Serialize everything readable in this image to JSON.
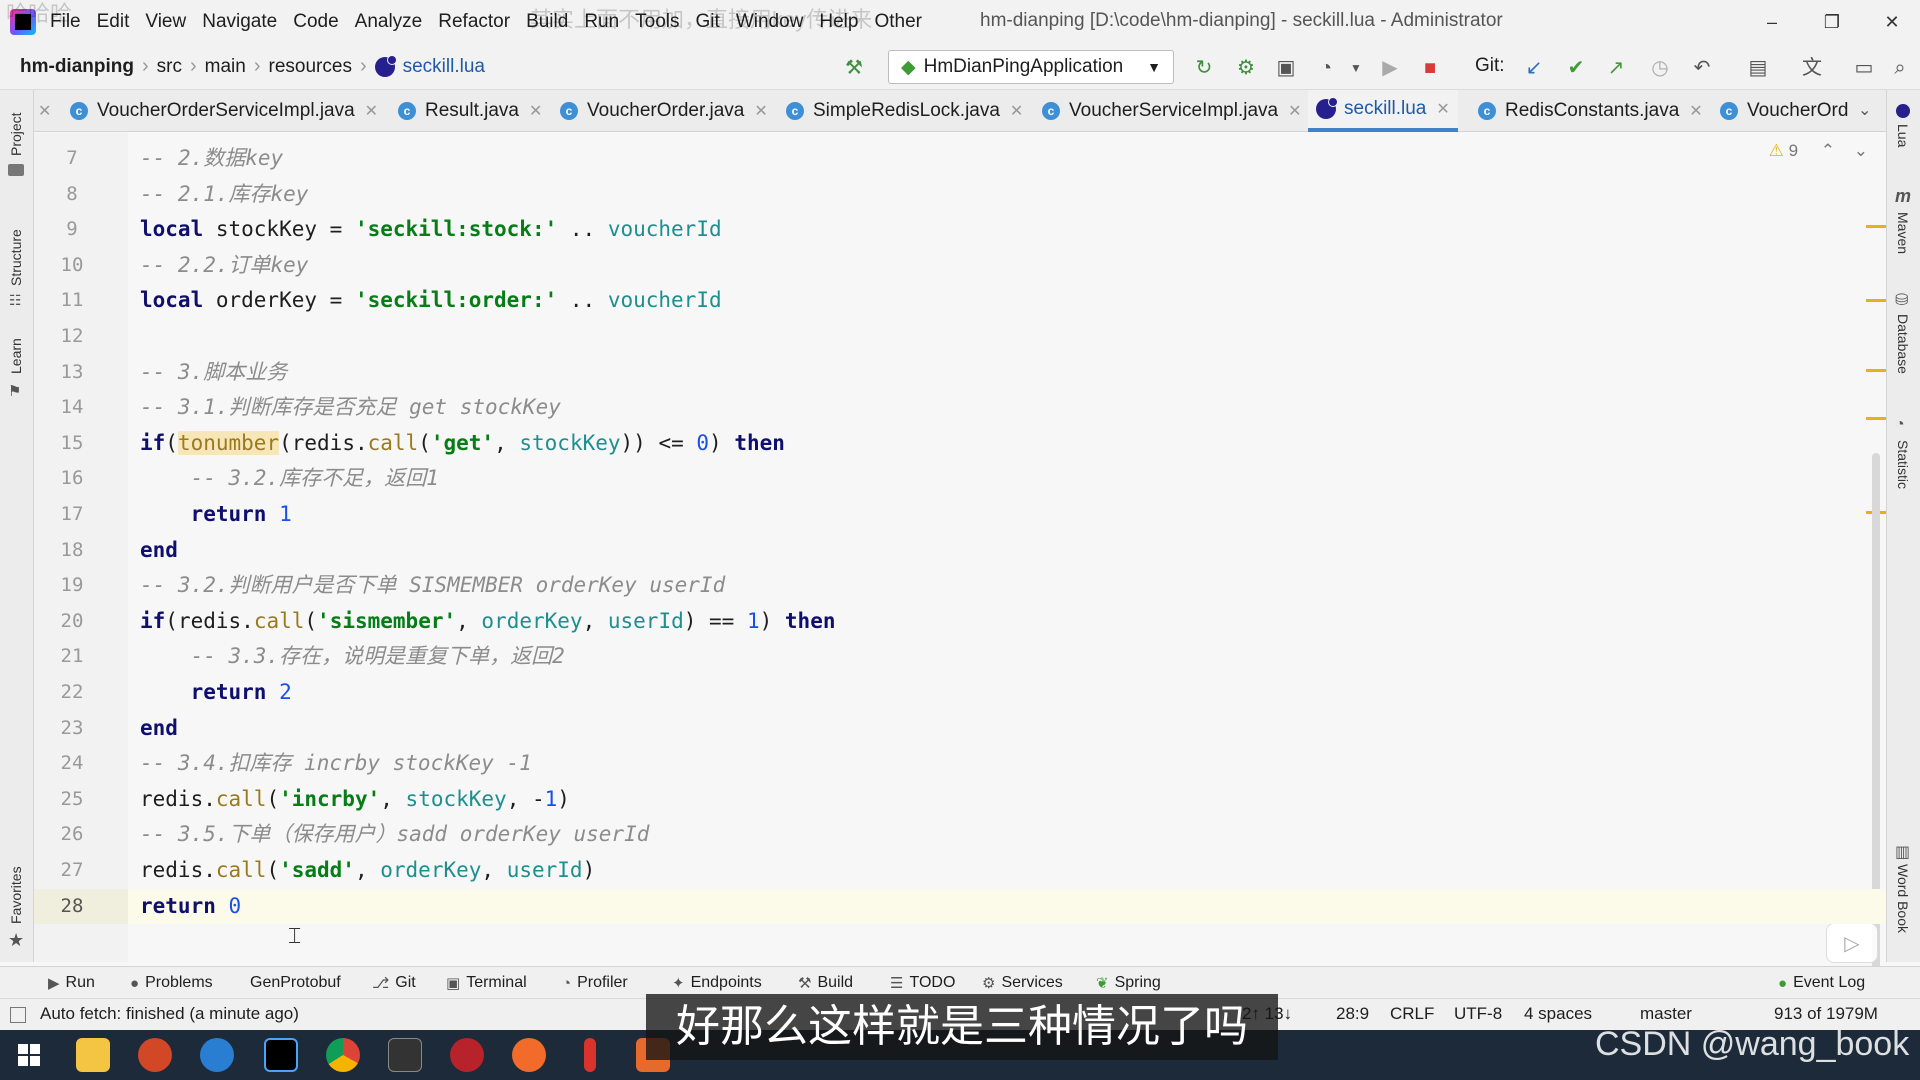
{
  "menubar": {
    "items": [
      "File",
      "Edit",
      "View",
      "Navigate",
      "Code",
      "Analyze",
      "Refactor",
      "Build",
      "Run",
      "Tools",
      "Git",
      "Window",
      "Help",
      "Other"
    ],
    "window_title": "hm-dianping [D:\\code\\hm-dianping] - seckill.lua - Administrator",
    "overlay_left": "哈哈哈",
    "overlay_right": "其实上面不用加，直接用key传进来"
  },
  "navbar": {
    "crumbs": [
      "hm-dianping",
      "src",
      "main",
      "resources",
      "seckill.lua"
    ],
    "run_config": "HmDianPingApplication",
    "git_label": "Git:"
  },
  "tabs": [
    {
      "label": "VoucherOrderServiceImpl.java",
      "icon": "class-icon"
    },
    {
      "label": "Result.java",
      "icon": "class-icon"
    },
    {
      "label": "VoucherOrder.java",
      "icon": "class-icon"
    },
    {
      "label": "SimpleRedisLock.java",
      "icon": "class-icon"
    },
    {
      "label": "VoucherServiceImpl.java",
      "icon": "class-icon"
    },
    {
      "label": "seckill.lua",
      "icon": "lua-icon",
      "active": true
    },
    {
      "label": "RedisConstants.java",
      "icon": "class-icon"
    },
    {
      "label": "VoucherOrd",
      "icon": "class-icon"
    }
  ],
  "left_tools": [
    "Project",
    "Structure",
    "Learn",
    "Favorites"
  ],
  "right_tools": [
    "Lua",
    "Maven",
    "Database",
    "Statistic",
    "Word Book"
  ],
  "editor": {
    "warning_count": "9",
    "current_line": 28,
    "lines": [
      {
        "no": "7",
        "tokens": [
          {
            "t": "-- 2.数据key",
            "c": "c"
          }
        ]
      },
      {
        "no": "8",
        "tokens": [
          {
            "t": "-- 2.1.库存key",
            "c": "c"
          }
        ]
      },
      {
        "no": "9",
        "tokens": [
          {
            "t": "local",
            "c": "k"
          },
          {
            "t": " stockKey = ",
            "c": "p"
          },
          {
            "t": "'seckill:stock:'",
            "c": "s"
          },
          {
            "t": " .. ",
            "c": "p"
          },
          {
            "t": "voucherId",
            "c": "v"
          }
        ]
      },
      {
        "no": "10",
        "tokens": [
          {
            "t": "-- 2.2.订单key",
            "c": "c"
          }
        ]
      },
      {
        "no": "11",
        "tokens": [
          {
            "t": "local",
            "c": "k"
          },
          {
            "t": " orderKey = ",
            "c": "p"
          },
          {
            "t": "'seckill:order:'",
            "c": "s"
          },
          {
            "t": " .. ",
            "c": "p"
          },
          {
            "t": "voucherId",
            "c": "v"
          }
        ]
      },
      {
        "no": "12",
        "tokens": []
      },
      {
        "no": "13",
        "tokens": [
          {
            "t": "-- 3.脚本业务",
            "c": "c"
          }
        ]
      },
      {
        "no": "14",
        "tokens": [
          {
            "t": "-- 3.1.判断库存是否充足 get stockKey",
            "c": "c"
          }
        ]
      },
      {
        "no": "15",
        "tokens": [
          {
            "t": "if",
            "c": "k"
          },
          {
            "t": "(",
            "c": "p"
          },
          {
            "t": "tonumber",
            "c": "hl"
          },
          {
            "t": "(redis.",
            "c": "p"
          },
          {
            "t": "call",
            "c": "f"
          },
          {
            "t": "(",
            "c": "p"
          },
          {
            "t": "'get'",
            "c": "s"
          },
          {
            "t": ", ",
            "c": "p"
          },
          {
            "t": "stockKey",
            "c": "v"
          },
          {
            "t": ")) <= ",
            "c": "p"
          },
          {
            "t": "0",
            "c": "n"
          },
          {
            "t": ") ",
            "c": "p"
          },
          {
            "t": "then",
            "c": "k"
          }
        ]
      },
      {
        "no": "16",
        "tokens": [
          {
            "t": "    -- 3.2.库存不足，返回1",
            "c": "c"
          }
        ]
      },
      {
        "no": "17",
        "tokens": [
          {
            "t": "    ",
            "c": "p"
          },
          {
            "t": "return",
            "c": "k"
          },
          {
            "t": " ",
            "c": "p"
          },
          {
            "t": "1",
            "c": "n"
          }
        ]
      },
      {
        "no": "18",
        "tokens": [
          {
            "t": "end",
            "c": "k"
          }
        ]
      },
      {
        "no": "19",
        "tokens": [
          {
            "t": "-- 3.2.判断用户是否下单 SISMEMBER orderKey userId",
            "c": "c"
          }
        ]
      },
      {
        "no": "20",
        "tokens": [
          {
            "t": "if",
            "c": "k"
          },
          {
            "t": "(redis.",
            "c": "p"
          },
          {
            "t": "call",
            "c": "f"
          },
          {
            "t": "(",
            "c": "p"
          },
          {
            "t": "'sismember'",
            "c": "s"
          },
          {
            "t": ", ",
            "c": "p"
          },
          {
            "t": "orderKey",
            "c": "v"
          },
          {
            "t": ", ",
            "c": "p"
          },
          {
            "t": "userId",
            "c": "v"
          },
          {
            "t": ") == ",
            "c": "p"
          },
          {
            "t": "1",
            "c": "n"
          },
          {
            "t": ") ",
            "c": "p"
          },
          {
            "t": "then",
            "c": "k"
          }
        ]
      },
      {
        "no": "21",
        "tokens": [
          {
            "t": "    -- 3.3.存在，说明是重复下单，返回2",
            "c": "c"
          }
        ]
      },
      {
        "no": "22",
        "tokens": [
          {
            "t": "    ",
            "c": "p"
          },
          {
            "t": "return",
            "c": "k"
          },
          {
            "t": " ",
            "c": "p"
          },
          {
            "t": "2",
            "c": "n"
          }
        ]
      },
      {
        "no": "23",
        "tokens": [
          {
            "t": "end",
            "c": "k"
          }
        ]
      },
      {
        "no": "24",
        "tokens": [
          {
            "t": "-- 3.4.扣库存 incrby stockKey -1",
            "c": "c"
          }
        ]
      },
      {
        "no": "25",
        "tokens": [
          {
            "t": "redis.",
            "c": "p"
          },
          {
            "t": "call",
            "c": "f"
          },
          {
            "t": "(",
            "c": "p"
          },
          {
            "t": "'incrby'",
            "c": "s"
          },
          {
            "t": ", ",
            "c": "p"
          },
          {
            "t": "stockKey",
            "c": "v"
          },
          {
            "t": ", -",
            "c": "p"
          },
          {
            "t": "1",
            "c": "n"
          },
          {
            "t": ")",
            "c": "p"
          }
        ]
      },
      {
        "no": "26",
        "tokens": [
          {
            "t": "-- 3.5.下单（保存用户）sadd orderKey userId",
            "c": "c"
          }
        ]
      },
      {
        "no": "27",
        "tokens": [
          {
            "t": "redis.",
            "c": "p"
          },
          {
            "t": "call",
            "c": "f"
          },
          {
            "t": "(",
            "c": "p"
          },
          {
            "t": "'sadd'",
            "c": "s"
          },
          {
            "t": ", ",
            "c": "p"
          },
          {
            "t": "orderKey",
            "c": "v"
          },
          {
            "t": ", ",
            "c": "p"
          },
          {
            "t": "userId",
            "c": "v"
          },
          {
            "t": ")",
            "c": "p"
          }
        ]
      },
      {
        "no": "28",
        "tokens": [
          {
            "t": "return",
            "c": "k"
          },
          {
            "t": " ",
            "c": "p"
          },
          {
            "t": "0",
            "c": "n"
          }
        ]
      }
    ]
  },
  "bottom_tools": [
    "Run",
    "Problems",
    "GenProtobuf",
    "Git",
    "Terminal",
    "Profiler",
    "Endpoints",
    "Build",
    "TODO",
    "Services",
    "Spring",
    "Event Log"
  ],
  "statusbar": {
    "message": "Auto fetch: finished (a minute ago)",
    "git_sync": "2↑ 13↓",
    "position": "28:9",
    "line_sep": "CRLF",
    "encoding": "UTF-8",
    "indent": "4 spaces",
    "branch": "master",
    "memory": "913 of 1979M"
  },
  "subtitle": "好那么这样就是三种情况了吗",
  "watermark": "CSDN @wang_book",
  "colors": {
    "accent": "#4083c9",
    "keyword": "#0f0f6e",
    "string": "#067d17",
    "comment": "#8c8c8c",
    "warning": "#e7b01a"
  }
}
